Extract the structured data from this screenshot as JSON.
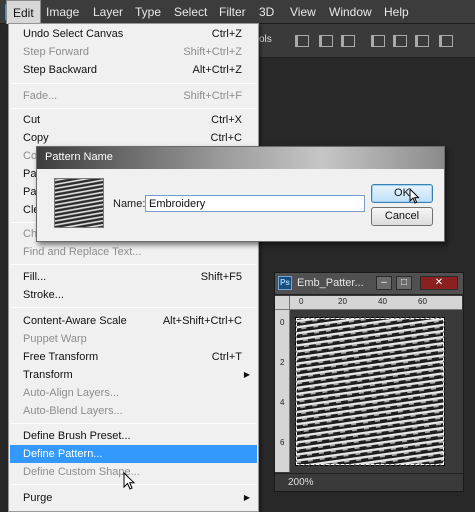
{
  "menubar": {
    "items": [
      "Edit",
      "Image",
      "Layer",
      "Type",
      "Select",
      "Filter",
      "3D",
      "View",
      "Window",
      "Help"
    ],
    "active": "Edit"
  },
  "options_bar": {
    "partial_label": "ols"
  },
  "edit_menu": {
    "items": [
      {
        "label": "Undo Select Canvas",
        "shortcut": "Ctrl+Z",
        "enabled": true
      },
      {
        "label": "Step Forward",
        "shortcut": "Shift+Ctrl+Z",
        "enabled": false
      },
      {
        "label": "Step Backward",
        "shortcut": "Alt+Ctrl+Z",
        "enabled": true
      },
      {
        "label": "Fade...",
        "shortcut": "Shift+Ctrl+F",
        "enabled": false
      },
      {
        "label": "Cut",
        "shortcut": "Ctrl+X",
        "enabled": true
      },
      {
        "label": "Copy",
        "shortcut": "Ctrl+C",
        "enabled": true
      },
      {
        "label": "Co",
        "shortcut": "",
        "enabled": false
      },
      {
        "label": "Pas",
        "shortcut": "",
        "enabled": true
      },
      {
        "label": "Pas",
        "shortcut": "",
        "enabled": true
      },
      {
        "label": "Cle",
        "shortcut": "",
        "enabled": true
      },
      {
        "label": "Ch",
        "shortcut": "",
        "enabled": false
      },
      {
        "label": "Find and Replace Text...",
        "shortcut": "",
        "enabled": false
      },
      {
        "label": "Fill...",
        "shortcut": "Shift+F5",
        "enabled": true
      },
      {
        "label": "Stroke...",
        "shortcut": "",
        "enabled": true
      },
      {
        "label": "Content-Aware Scale",
        "shortcut": "Alt+Shift+Ctrl+C",
        "enabled": true
      },
      {
        "label": "Puppet Warp",
        "shortcut": "",
        "enabled": false
      },
      {
        "label": "Free Transform",
        "shortcut": "Ctrl+T",
        "enabled": true
      },
      {
        "label": "Transform",
        "shortcut": "",
        "enabled": true,
        "submenu": true
      },
      {
        "label": "Auto-Align Layers...",
        "shortcut": "",
        "enabled": false
      },
      {
        "label": "Auto-Blend Layers...",
        "shortcut": "",
        "enabled": false
      },
      {
        "label": "Define Brush Preset...",
        "shortcut": "",
        "enabled": true
      },
      {
        "label": "Define Pattern...",
        "shortcut": "",
        "enabled": true,
        "highlighted": true
      },
      {
        "label": "Define Custom Shape...",
        "shortcut": "",
        "enabled": false
      },
      {
        "label": "Purge",
        "shortcut": "",
        "enabled": true,
        "submenu": true
      }
    ]
  },
  "dialog": {
    "title": "Pattern Name",
    "name_label": "Name:",
    "name_value": "Embroidery",
    "ok_label": "OK",
    "cancel_label": "Cancel"
  },
  "document": {
    "title": "Emb_Patter...",
    "ps_badge": "Ps",
    "minimize": "–",
    "maximize": "□",
    "close": "✕",
    "ruler_h_ticks": [
      "0",
      "20",
      "40",
      "60"
    ],
    "ruler_v_ticks": [
      "0",
      "2",
      "4",
      "6"
    ],
    "zoom": "200%"
  }
}
